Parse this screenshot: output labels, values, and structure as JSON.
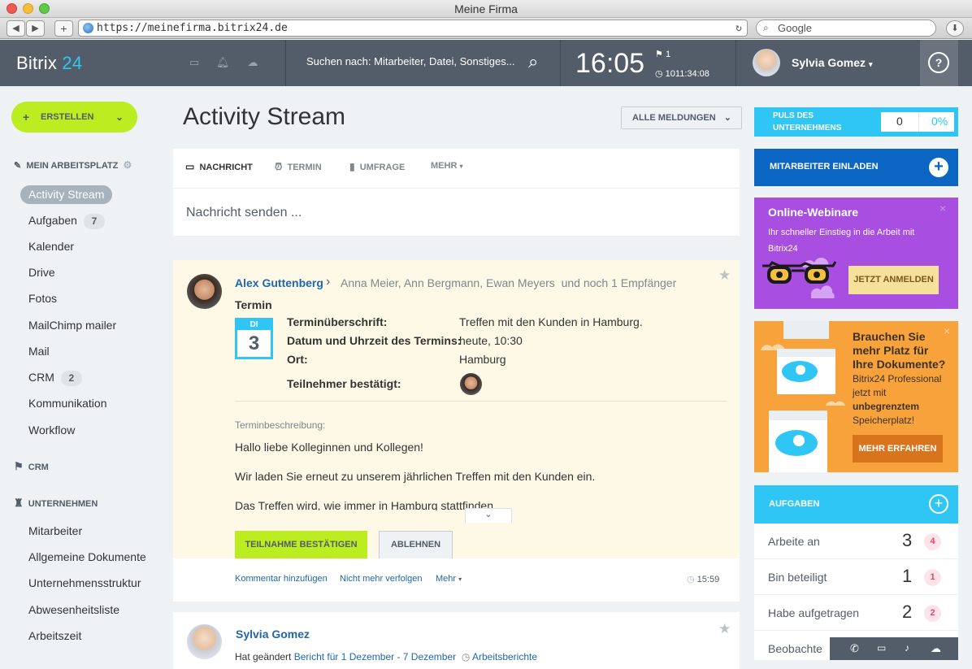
{
  "window": {
    "title": "Meine Firma"
  },
  "browser": {
    "url": "https://meinefirma.bitrix24.de",
    "search_placeholder": "Google"
  },
  "header": {
    "brand_name": "Bitrix",
    "brand_num": "24",
    "search_placeholder": "Suchen nach: Mitarbeiter, Datei, Sonstiges...",
    "clock": "16:05",
    "flag_count": "1",
    "timer": "1011:34:08",
    "user_name": "Sylvia Gomez",
    "help": "?"
  },
  "sidebar": {
    "create_label": "ERSTELLEN",
    "workspace_label": "MEIN ARBEITSPLATZ",
    "items": [
      {
        "label": "Activity Stream"
      },
      {
        "label": "Aufgaben",
        "badge": "7"
      },
      {
        "label": "Kalender"
      },
      {
        "label": "Drive"
      },
      {
        "label": "Fotos"
      },
      {
        "label": "MailChimp mailer"
      },
      {
        "label": "Mail"
      },
      {
        "label": "CRM",
        "badge": "2"
      },
      {
        "label": "Kommunikation"
      },
      {
        "label": "Workflow"
      }
    ],
    "crm_label": "CRM",
    "company_label": "UNTERNEHMEN",
    "company_items": [
      "Mitarbeiter",
      "Allgemeine Dokumente",
      "Unternehmensstruktur",
      "Abwesenheitsliste",
      "Arbeitszeit"
    ]
  },
  "main": {
    "title": "Activity Stream",
    "filter_label": "ALLE MELDUNGEN",
    "composer": {
      "tabs": [
        "NACHRICHT",
        "TERMIN",
        "UMFRAGE",
        "MEHR"
      ],
      "placeholder": "Nachricht senden ..."
    },
    "post1": {
      "author": "Alex Guttenberg",
      "recipients": "Anna Meier, Ann Bergmann, Ewan Meyers",
      "recipients_more": "und noch 1 Empfänger",
      "type": "Termin",
      "cal_day": "DI",
      "cal_date": "3",
      "fields": {
        "subject_label": "Terminüberschrift:",
        "subject_value": "Treffen mit den Kunden in Hamburg.",
        "datetime_label": "Datum und Uhrzeit des Termins:",
        "datetime_value": "heute, 10:30",
        "place_label": "Ort:",
        "place_value": "Hamburg",
        "attendees_label": "Teilnehmer bestätigt:"
      },
      "desc_label": "Terminbeschreibung:",
      "desc_lines": [
        "Hallo liebe Kolleginnen und Kollegen!",
        "Wir laden Sie erneut zu unserem jährlichen Treffen mit den Kunden ein.",
        "Das Treffen wird, wie immer in Hamburg stattfinden"
      ],
      "confirm_label": "TEILNAHME BESTÄTIGEN",
      "decline_label": "ABLEHNEN",
      "actions": [
        "Kommentar hinzufügen",
        "Nicht mehr verfolgen",
        "Mehr"
      ],
      "time": "15:59"
    },
    "post2": {
      "author": "Sylvia Gomez",
      "changed_prefix": "Hat geändert",
      "changed_link": "Bericht für 1 Dezember - 7 Dezember",
      "category_link": "Arbeitsberichte"
    }
  },
  "right": {
    "puls": {
      "label_line1": "PULS DES",
      "label_line2": "UNTERNEHMENS",
      "value": "0",
      "percent": "0%"
    },
    "invite_label": "MITARBEITER EINLADEN",
    "webinar": {
      "title": "Online-Webinare",
      "text_line1": "Ihr schneller Einstieg in die Arbeit mit",
      "text_line2": "Bitrix24",
      "button": "JETZT ANMELDEN"
    },
    "storage": {
      "title_line1": "Brauchen Sie",
      "title_line2": "mehr Platz für",
      "title_line3": "Ihre Dokumente?",
      "text_line1": "Bitrix24 Professional",
      "text_line2": "jetzt mit",
      "text_bold": "unbegrenztem",
      "text_line3": "Speicherplatz!",
      "button": "MEHR ERFAHREN"
    },
    "tasks": {
      "title": "AUFGABEN",
      "rows": [
        {
          "label": "Arbeite an",
          "count": "3",
          "badge": "4"
        },
        {
          "label": "Bin beteiligt",
          "count": "1",
          "badge": "1"
        },
        {
          "label": "Habe aufgetragen",
          "count": "2",
          "badge": "2"
        },
        {
          "label": "Beobachte"
        }
      ]
    }
  },
  "colors": {
    "accent_green": "#bbed21",
    "accent_blue": "#2fc6f6",
    "header": "#535c69",
    "link": "#2067b0"
  }
}
